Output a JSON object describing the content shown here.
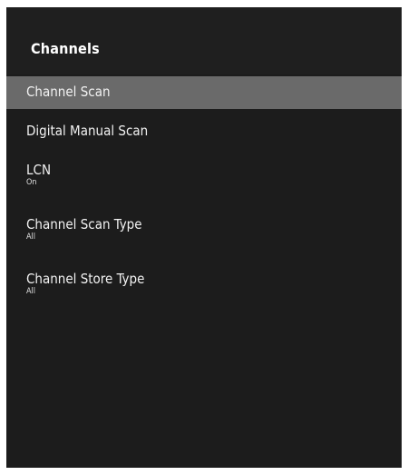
{
  "header": {
    "title": "Channels"
  },
  "menu": {
    "items": [
      {
        "label": "Channel Scan",
        "sub": "",
        "selected": true
      },
      {
        "label": "Digital Manual Scan",
        "sub": ""
      },
      {
        "label": "LCN",
        "sub": "On"
      },
      {
        "label": "Channel Scan Type",
        "sub": "All"
      },
      {
        "label": "Channel Store Type",
        "sub": "All"
      }
    ]
  },
  "colors": {
    "panel_background": "#1c1c1c",
    "selected_background": "#6a6a6a",
    "text": "#ffffff"
  }
}
